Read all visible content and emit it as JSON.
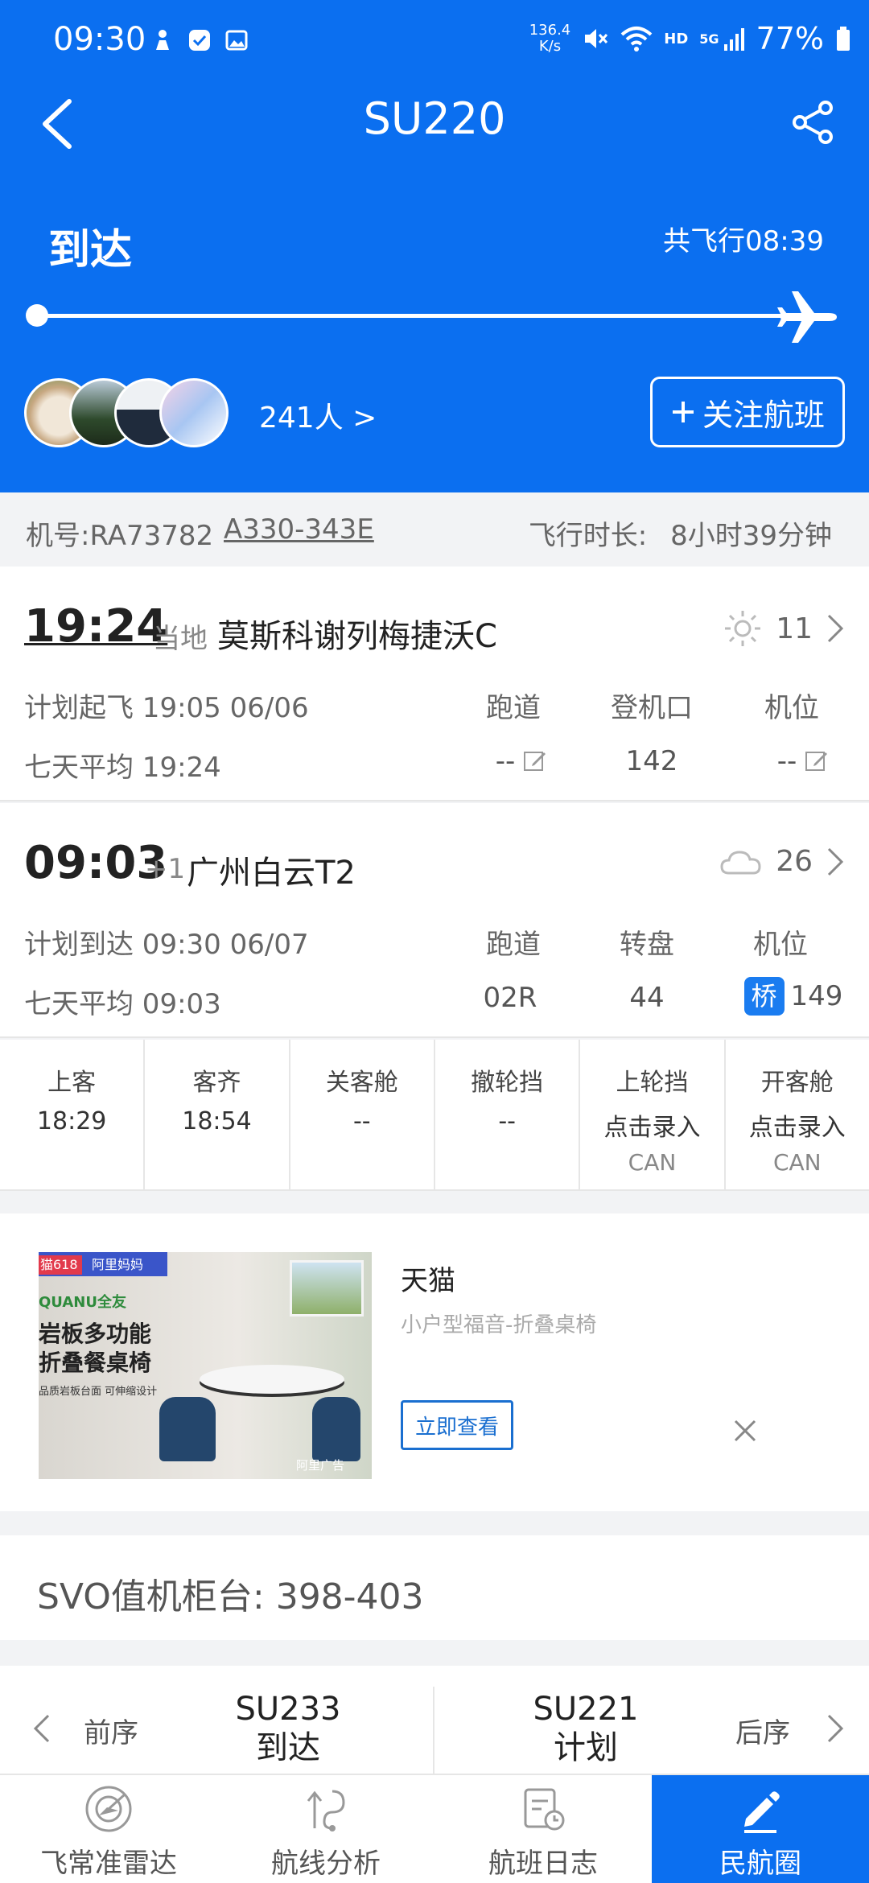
{
  "status_bar": {
    "time": "09:30",
    "net_speed_value": "136.4",
    "net_speed_unit": "K/s",
    "hd": "HD",
    "signal": "5G",
    "battery": "77%"
  },
  "header": {
    "flight_no": "SU220",
    "status": "到达",
    "total_flight": "共飞行08:39",
    "progress": 1.0,
    "followers": "241人 >",
    "follow_label": "关注航班"
  },
  "aircraft": {
    "reg": "机号:RA73782",
    "type": "A330-343E",
    "duration_label": "飞行时长:",
    "duration_value": "8小时39分钟"
  },
  "departure": {
    "time": "19:24",
    "suffix": "当地",
    "airport": "莫斯科谢列梅捷沃C",
    "weather_icon": "sun-icon",
    "temp": "11",
    "planned": "计划起飞 19:05 06/06",
    "avg": "七天平均 19:24",
    "cols": [
      {
        "header": "跑道",
        "value": "--"
      },
      {
        "header": "登机口",
        "value": "142"
      },
      {
        "header": "机位",
        "value": "--"
      }
    ]
  },
  "arrival": {
    "time": "09:03",
    "suffix": "+1",
    "airport": "广州白云T2",
    "weather_icon": "cloud-icon",
    "temp": "26",
    "planned": "计划到达 09:30 06/07",
    "avg": "七天平均 09:03",
    "cols": [
      {
        "header": "跑道",
        "value": "02R"
      },
      {
        "header": "转盘",
        "value": "44"
      },
      {
        "header": "机位",
        "value": "149",
        "badge": "桥"
      }
    ]
  },
  "events": [
    {
      "label": "上客",
      "value": "18:29",
      "sub": ""
    },
    {
      "label": "客齐",
      "value": "18:54",
      "sub": ""
    },
    {
      "label": "关客舱",
      "value": "--",
      "sub": ""
    },
    {
      "label": "撤轮挡",
      "value": "--",
      "sub": ""
    },
    {
      "label": "上轮挡",
      "value": "点击录入",
      "sub": "CAN"
    },
    {
      "label": "开客舱",
      "value": "点击录入",
      "sub": "CAN"
    }
  ],
  "ad": {
    "title": "天猫",
    "subtitle": "小户型福音-折叠桌椅",
    "button": "立即查看",
    "image_text": {
      "badge_left": "猫618",
      "badge_right": "阿里妈妈",
      "brand": "QUANU全友",
      "headline1": "岩板多功能",
      "headline2": "折叠餐桌椅",
      "tagline": "品质岩板台面 可伸缩设计",
      "ad_mark": "阿里广告"
    }
  },
  "counter": {
    "text": "SVO值机柜台:  398-403"
  },
  "sequence": {
    "prev_label": "前序",
    "prev_flight": "SU233",
    "prev_status": "到达",
    "next_flight": "SU221",
    "next_status": "计划",
    "next_label": "后序"
  },
  "bottom_nav": [
    {
      "label": "飞常准雷达",
      "icon": "radar-icon"
    },
    {
      "label": "航线分析",
      "icon": "route-icon"
    },
    {
      "label": "航班日志",
      "icon": "log-icon"
    },
    {
      "label": "民航圈",
      "icon": "pen-icon",
      "active": true
    }
  ],
  "colors": {
    "primary": "#0b6ff0",
    "badge": "#1a7cf0",
    "ad_button": "#1a6fd0"
  }
}
